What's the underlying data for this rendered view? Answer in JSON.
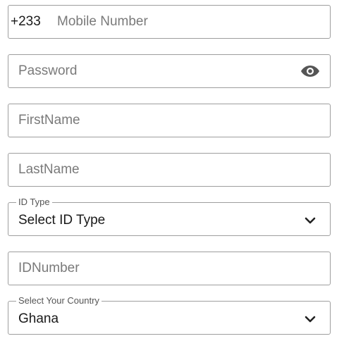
{
  "form": {
    "mobile": {
      "prefix": "+233",
      "placeholder": "Mobile Number"
    },
    "password": {
      "placeholder": "Password",
      "toggle_icon": "eye-icon"
    },
    "first_name": {
      "placeholder": "FirstName"
    },
    "last_name": {
      "placeholder": "LastName"
    },
    "id_type": {
      "label": "ID Type",
      "value": "Select ID Type",
      "icon": "chevron-down-icon"
    },
    "id_number": {
      "placeholder": "IDNumber"
    },
    "country": {
      "label": "Select Your Country",
      "value": "Ghana",
      "icon": "chevron-down-icon"
    }
  }
}
